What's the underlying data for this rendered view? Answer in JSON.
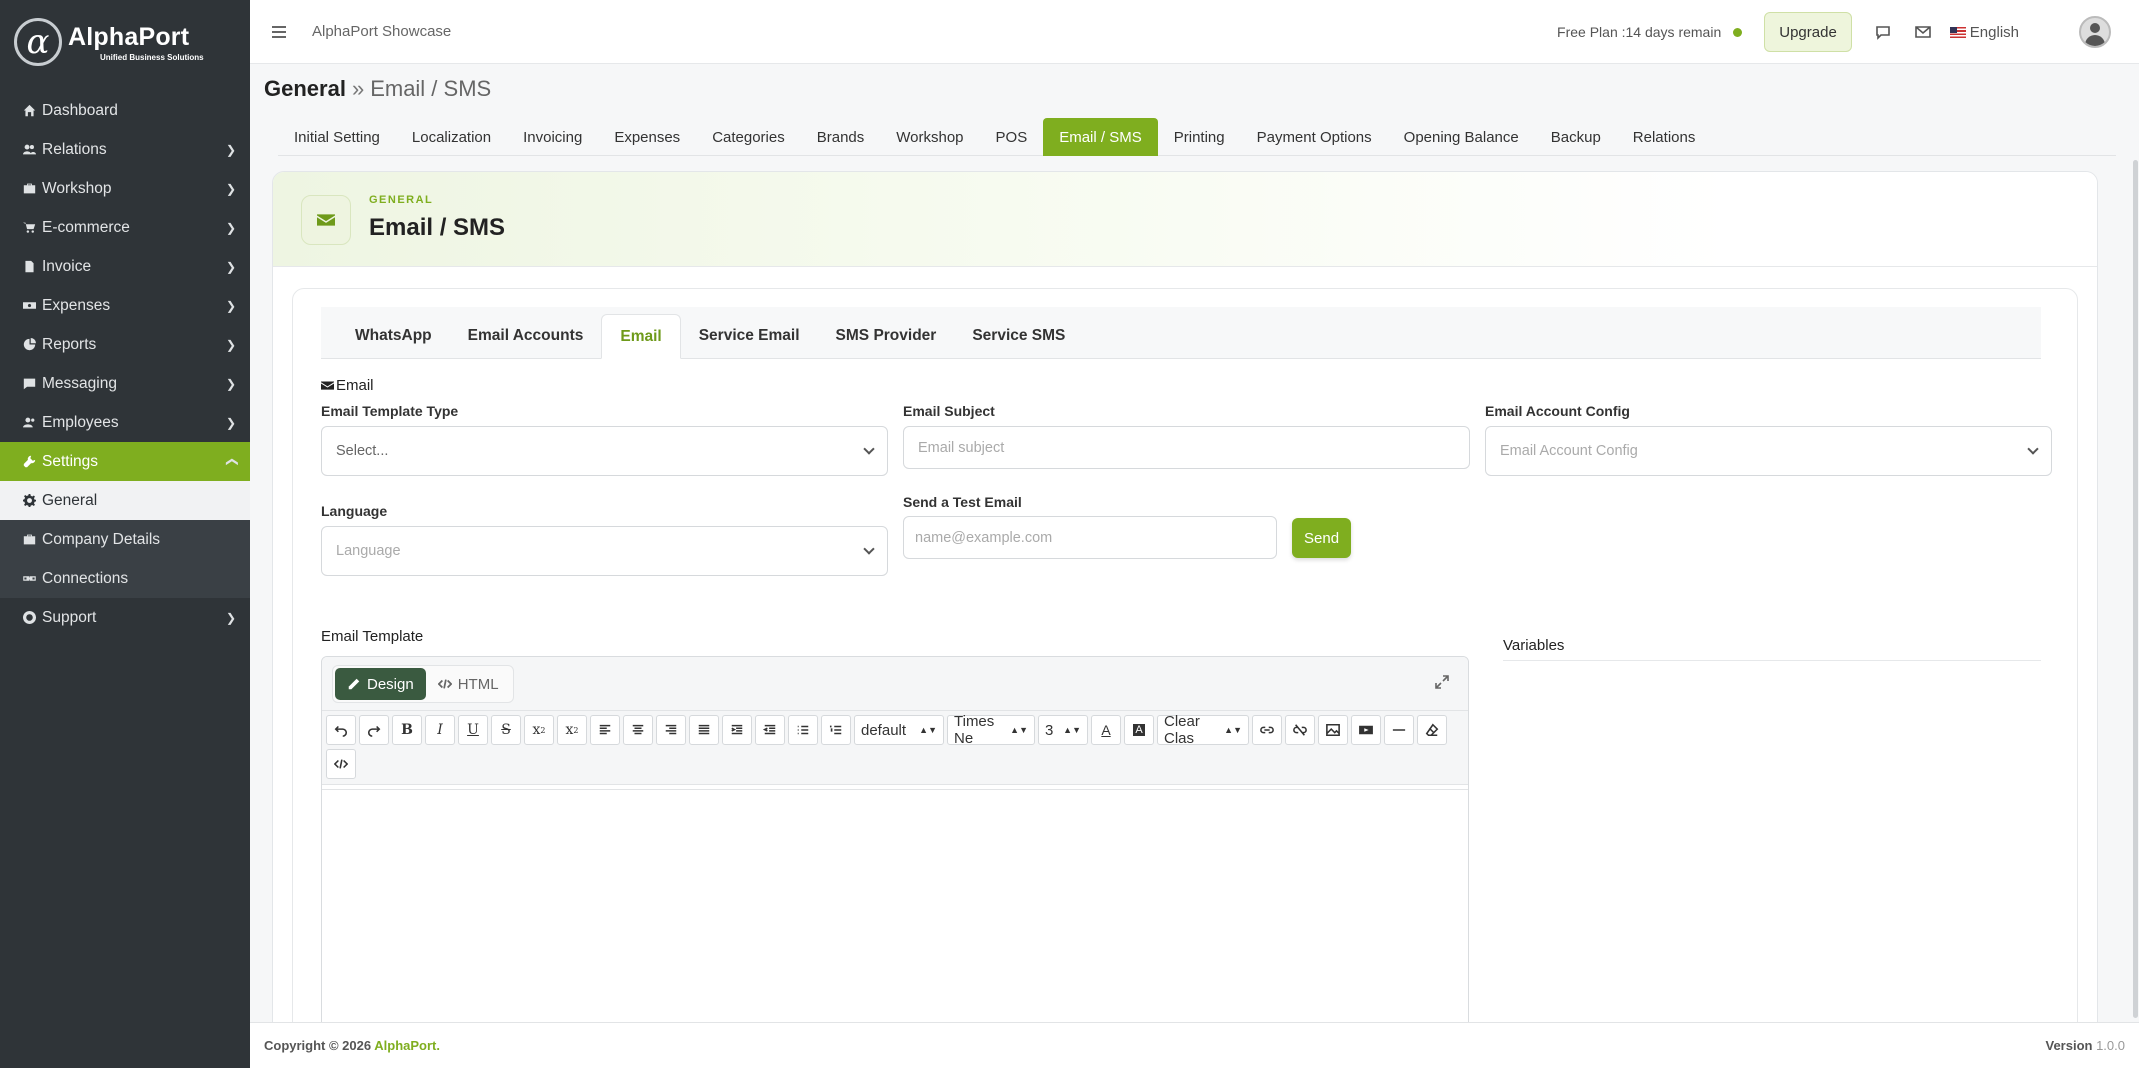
{
  "brand": {
    "name": "AlphaPort",
    "tagline": "Unified Business Solutions",
    "logo_glyph": "α",
    "accent": "#7fae1f",
    "sidebar_bg": "#2f3438"
  },
  "sidebar": {
    "items": [
      {
        "label": "Dashboard",
        "icon": "home-icon",
        "chevron": false
      },
      {
        "label": "Relations",
        "icon": "users-icon",
        "chevron": true
      },
      {
        "label": "Workshop",
        "icon": "briefcase-icon",
        "chevron": true
      },
      {
        "label": "E-commerce",
        "icon": "cart-icon",
        "chevron": true
      },
      {
        "label": "Invoice",
        "icon": "file-icon",
        "chevron": true
      },
      {
        "label": "Expenses",
        "icon": "money-icon",
        "chevron": true
      },
      {
        "label": "Reports",
        "icon": "pie-chart-icon",
        "chevron": true
      },
      {
        "label": "Messaging",
        "icon": "message-icon",
        "chevron": true
      },
      {
        "label": "Employees",
        "icon": "user-group-icon",
        "chevron": true
      }
    ],
    "settings": {
      "label": "Settings",
      "icon": "tools-icon"
    },
    "settings_sub": [
      {
        "label": "General",
        "icon": "gear-icon"
      },
      {
        "label": "Company Details",
        "icon": "building-icon"
      },
      {
        "label": "Connections",
        "icon": "link-icon"
      }
    ],
    "support": {
      "label": "Support",
      "icon": "lifebuoy-icon"
    }
  },
  "header": {
    "title": "AlphaPort Showcase",
    "plan_text": "Free Plan :14 days remain",
    "upgrade_label": "Upgrade",
    "language": "English"
  },
  "breadcrumb": {
    "root": "General",
    "separator": "»",
    "current": "Email / SMS"
  },
  "main_tabs": [
    "Initial Setting",
    "Localization",
    "Invoicing",
    "Expenses",
    "Categories",
    "Brands",
    "Workshop",
    "POS",
    "Email / SMS",
    "Printing",
    "Payment Options",
    "Opening Balance",
    "Backup",
    "Relations"
  ],
  "main_tab_active": "Email / SMS",
  "card": {
    "eyebrow": "GENERAL",
    "title": "Email / SMS"
  },
  "sub_tabs": [
    "WhatsApp",
    "Email Accounts",
    "Email",
    "Service Email",
    "SMS Provider",
    "Service SMS"
  ],
  "sub_tab_active": "Email",
  "form": {
    "section": "Email",
    "template_type": {
      "label": "Email Template Type",
      "value": "Select..."
    },
    "subject": {
      "label": "Email Subject",
      "placeholder": "Email subject"
    },
    "account_config": {
      "label": "Email Account Config",
      "placeholder": "Email Account Config"
    },
    "language": {
      "label": "Language",
      "placeholder": "Language"
    },
    "test_email": {
      "label": "Send a Test Email",
      "placeholder": "name@example.com",
      "button": "Send"
    },
    "template_label": "Email Template",
    "variables_label": "Variables"
  },
  "editor": {
    "modes": [
      "Design",
      "HTML"
    ],
    "active_mode": "Design",
    "selects": {
      "style": "default",
      "font": "Times Ne",
      "size": "3",
      "clear": "Clear Clas"
    }
  },
  "footer": {
    "copyright": "Copyright © 2026",
    "brand": "AlphaPort.",
    "version_label": "Version",
    "version": "1.0.0"
  }
}
